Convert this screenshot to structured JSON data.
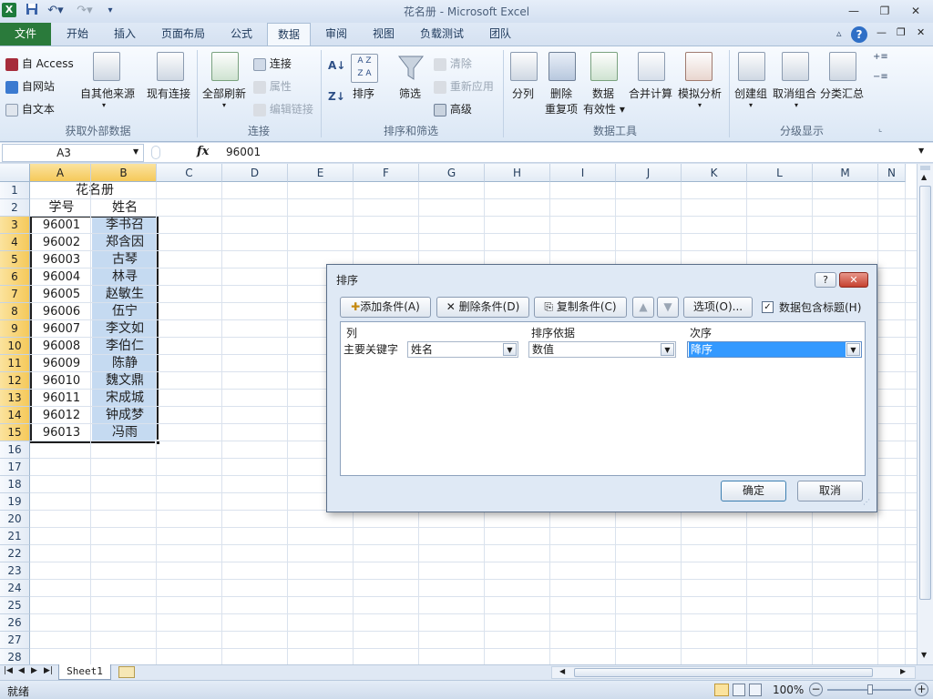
{
  "window": {
    "title": "花名册 - Microsoft Excel",
    "minimize": "—",
    "restore": "❐",
    "close": "✕"
  },
  "tabs": [
    {
      "label": "文件"
    },
    {
      "label": "开始"
    },
    {
      "label": "插入"
    },
    {
      "label": "页面布局"
    },
    {
      "label": "公式"
    },
    {
      "label": "数据"
    },
    {
      "label": "审阅"
    },
    {
      "label": "视图"
    },
    {
      "label": "负载测试"
    },
    {
      "label": "团队"
    }
  ],
  "active_tab": "数据",
  "ribbon": {
    "get_external": {
      "access": "自 Access",
      "web": "自网站",
      "text": "自文本",
      "other": "自其他来源",
      "existing": "现有连接",
      "label": "获取外部数据"
    },
    "connections": {
      "refresh_all": "全部刷新",
      "connections": "连接",
      "properties": "属性",
      "edit_links": "编辑链接",
      "label": "连接"
    },
    "sort_filter": {
      "sort": "排序",
      "filter": "筛选",
      "clear": "清除",
      "reapply": "重新应用",
      "advanced": "高级",
      "label": "排序和筛选"
    },
    "data_tools": {
      "split": "分列",
      "remove_dup_1": "删除",
      "remove_dup_2": "重复项",
      "validation_1": "数据",
      "validation_2": "有效性",
      "consolidate": "合并计算",
      "whatif": "模拟分析",
      "label": "数据工具"
    },
    "outline": {
      "group": "创建组",
      "ungroup": "取消组合",
      "subtotal": "分类汇总",
      "label": "分级显示"
    }
  },
  "formula_bar": {
    "name_box": "A3",
    "fx": "fx",
    "value": "96001"
  },
  "columns": [
    "A",
    "B",
    "C",
    "D",
    "E",
    "F",
    "G",
    "H",
    "I",
    "J",
    "K",
    "L",
    "M",
    "N"
  ],
  "rows": [
    "1",
    "2",
    "3",
    "4",
    "5",
    "6",
    "7",
    "8",
    "9",
    "10",
    "11",
    "12",
    "13",
    "14",
    "15",
    "16",
    "17",
    "18",
    "19",
    "20",
    "21",
    "22",
    "23",
    "24",
    "25",
    "26",
    "27",
    "28"
  ],
  "sheet": {
    "title": "花名册",
    "header_id": "学号",
    "header_name": "姓名",
    "records": [
      {
        "id": "96001",
        "name": "李书召"
      },
      {
        "id": "96002",
        "name": "郑含因"
      },
      {
        "id": "96003",
        "name": "古琴"
      },
      {
        "id": "96004",
        "name": "林寻"
      },
      {
        "id": "96005",
        "name": "赵敏生"
      },
      {
        "id": "96006",
        "name": "伍宁"
      },
      {
        "id": "96007",
        "name": "李文如"
      },
      {
        "id": "96008",
        "name": "李伯仁"
      },
      {
        "id": "96009",
        "name": "陈静"
      },
      {
        "id": "96010",
        "name": "魏文鼎"
      },
      {
        "id": "96011",
        "name": "宋成城"
      },
      {
        "id": "96012",
        "name": "钟成梦"
      },
      {
        "id": "96013",
        "name": "冯雨"
      }
    ]
  },
  "sheet_tabs": {
    "active": "Sheet1"
  },
  "status": {
    "ready": "就绪",
    "zoom": "100%"
  },
  "sort_dialog": {
    "title": "排序",
    "help": "?",
    "add_level": "添加条件(A)",
    "delete_level": "删除条件(D)",
    "copy_level": "复制条件(C)",
    "options": "选项(O)...",
    "has_headers": "数据包含标题(H)",
    "has_headers_checked": true,
    "col_header": "列",
    "sort_on_header": "排序依据",
    "order_header": "次序",
    "row_label": "主要关键字",
    "column_value": "姓名",
    "sort_on_value": "数值",
    "order_value": "降序",
    "ok": "确定",
    "cancel": "取消"
  }
}
